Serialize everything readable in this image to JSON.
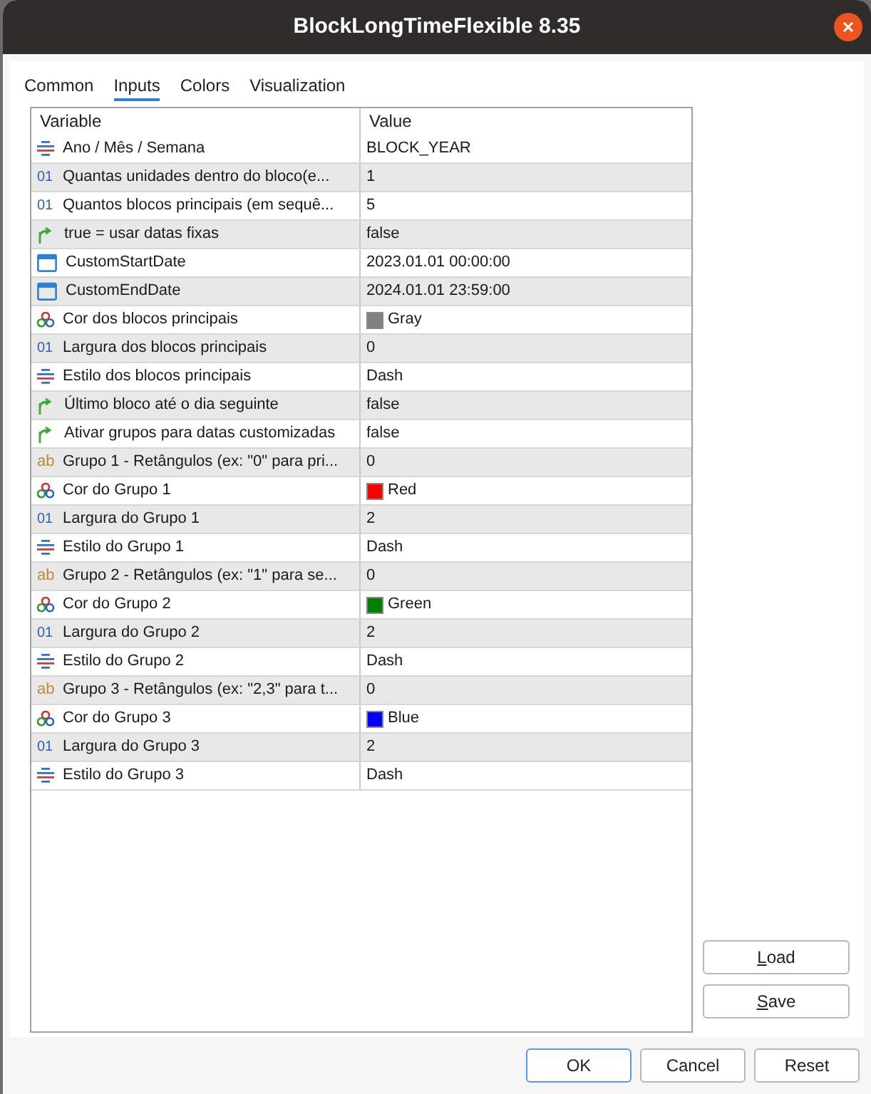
{
  "window": {
    "title": "BlockLongTimeFlexible 8.35"
  },
  "tabs": [
    {
      "label": "Common",
      "selected": false
    },
    {
      "label": "Inputs",
      "selected": true
    },
    {
      "label": "Colors",
      "selected": false
    },
    {
      "label": "Visualization",
      "selected": false
    }
  ],
  "table": {
    "columns": [
      "Variable",
      "Value"
    ],
    "rows": [
      {
        "kind": "enum",
        "variable": "Ano / Mês / Semana",
        "value": "BLOCK_YEAR"
      },
      {
        "kind": "int",
        "icon_text": "01",
        "variable": "Quantas unidades dentro do bloco(e...",
        "value": "1"
      },
      {
        "kind": "int",
        "icon_text": "01",
        "variable": "Quantos blocos principais (em sequê...",
        "value": "5"
      },
      {
        "kind": "bool",
        "variable": "true = usar datas fixas",
        "value": "false"
      },
      {
        "kind": "datetime",
        "variable": "CustomStartDate",
        "value": "2023.01.01 00:00:00"
      },
      {
        "kind": "datetime",
        "variable": "CustomEndDate",
        "value": "2024.01.01 23:59:00"
      },
      {
        "kind": "color",
        "variable": "Cor dos blocos principais",
        "value": "Gray",
        "color": "#808080"
      },
      {
        "kind": "int",
        "icon_text": "01",
        "variable": "Largura dos blocos principais",
        "value": "0"
      },
      {
        "kind": "enum",
        "variable": "Estilo dos blocos principais",
        "value": "Dash"
      },
      {
        "kind": "bool",
        "variable": "Último bloco até o dia seguinte",
        "value": "false"
      },
      {
        "kind": "bool",
        "variable": "Ativar grupos para datas customizadas",
        "value": "false"
      },
      {
        "kind": "string",
        "icon_text": "ab",
        "variable": "Grupo 1 - Retângulos (ex: \"0\" para pri...",
        "value": "0"
      },
      {
        "kind": "color",
        "variable": "Cor do Grupo 1",
        "value": "Red",
        "color": "#ff0000"
      },
      {
        "kind": "int",
        "icon_text": "01",
        "variable": "Largura do Grupo 1",
        "value": "2"
      },
      {
        "kind": "enum",
        "variable": "Estilo do Grupo 1",
        "value": "Dash"
      },
      {
        "kind": "string",
        "icon_text": "ab",
        "variable": "Grupo 2 - Retângulos (ex: \"1\" para se...",
        "value": "0"
      },
      {
        "kind": "color",
        "variable": "Cor do Grupo 2",
        "value": "Green",
        "color": "#008000"
      },
      {
        "kind": "int",
        "icon_text": "01",
        "variable": "Largura do Grupo 2",
        "value": "2"
      },
      {
        "kind": "enum",
        "variable": "Estilo do Grupo 2",
        "value": "Dash"
      },
      {
        "kind": "string",
        "icon_text": "ab",
        "variable": "Grupo 3 - Retângulos (ex: \"2,3\" para t...",
        "value": "0"
      },
      {
        "kind": "color",
        "variable": "Cor do Grupo 3",
        "value": "Blue",
        "color": "#0000ff"
      },
      {
        "kind": "int",
        "icon_text": "01",
        "variable": "Largura do Grupo 3",
        "value": "2"
      },
      {
        "kind": "enum",
        "variable": "Estilo do Grupo 3",
        "value": "Dash"
      }
    ]
  },
  "side_buttons": [
    {
      "mnemonic": "L",
      "rest": "oad"
    },
    {
      "mnemonic": "S",
      "rest": "ave"
    }
  ],
  "buttons": [
    {
      "label": "OK",
      "default": true
    },
    {
      "label": "Cancel",
      "default": false
    },
    {
      "label": "Reset",
      "default": false
    }
  ]
}
